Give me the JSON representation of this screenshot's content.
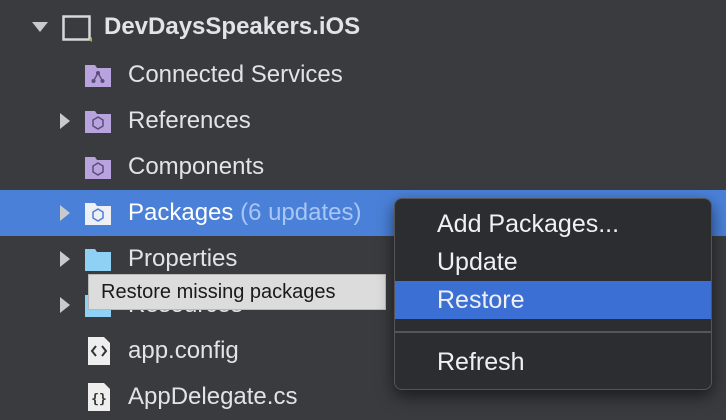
{
  "tree": {
    "project": {
      "label": "DevDaysSpeakers.iOS",
      "icon": "project-icon"
    },
    "items": [
      {
        "label": "Connected Services",
        "icon": "connected-services-icon"
      },
      {
        "label": "References",
        "icon": "references-icon"
      },
      {
        "label": "Components",
        "icon": "components-icon"
      },
      {
        "label": "Packages",
        "updates": "(6 updates)",
        "icon": "packages-icon"
      },
      {
        "label": "Properties",
        "icon": "folder-icon"
      },
      {
        "label": "Resources",
        "icon": "folder-icon"
      },
      {
        "label": "app.config",
        "icon": "config-file-icon"
      },
      {
        "label": "AppDelegate.cs",
        "icon": "csharp-file-icon"
      }
    ]
  },
  "tooltip": {
    "text": "Restore missing packages"
  },
  "context_menu": {
    "items": [
      "Add Packages...",
      "Update",
      "Restore",
      "Refresh"
    ],
    "highlighted": "Restore"
  },
  "colors": {
    "background": "#3a3b3f",
    "selection": "#4a80d8",
    "menu_highlight": "#3b6fd4",
    "folder_purple": "#b8a3df",
    "folder_blue": "#8ed1f5"
  }
}
